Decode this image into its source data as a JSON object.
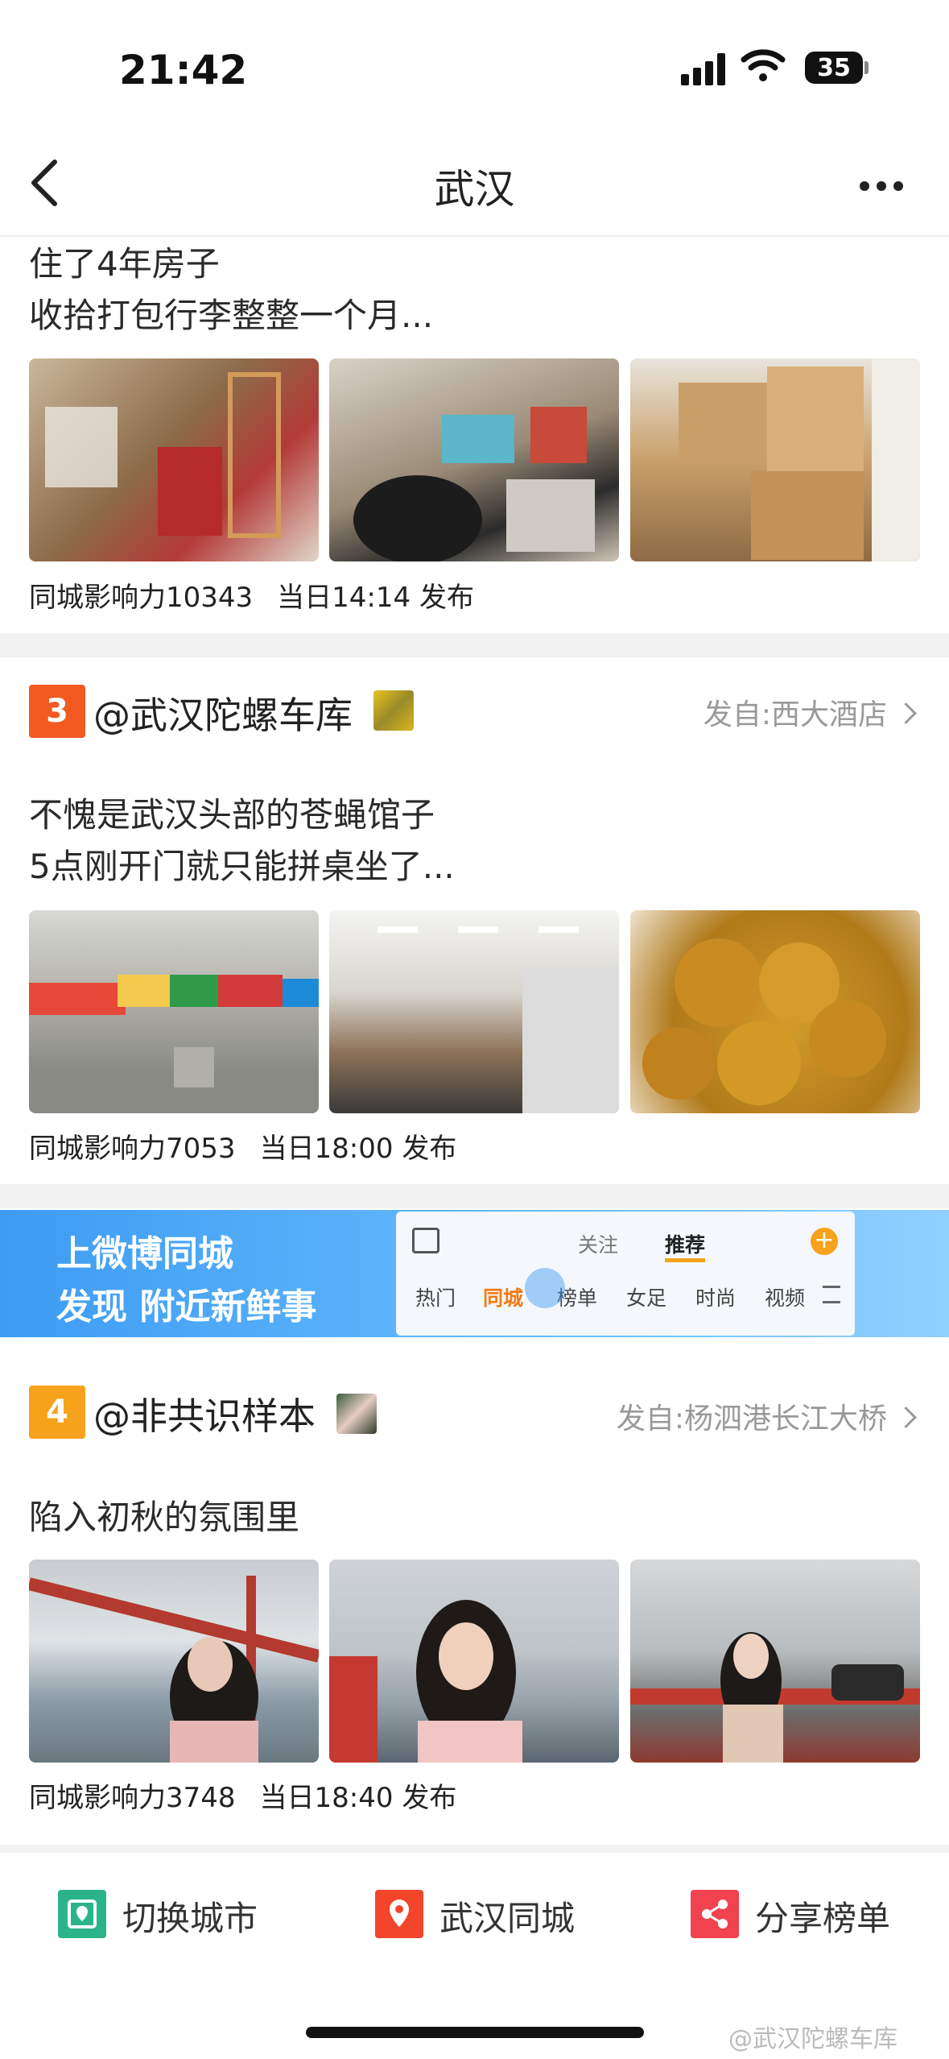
{
  "status": {
    "time": "21:42",
    "battery": "35"
  },
  "nav": {
    "title": "武汉"
  },
  "post1": {
    "text": "住了4年房子\n收拾打包行李整整一个月...",
    "influence_label": "同城影响力",
    "influence_value": "10343",
    "time": "当日14:14 发布"
  },
  "post2": {
    "rank": "3",
    "author": "@武汉陀螺车库",
    "from": "发自:西大酒店",
    "text": "不愧是武汉头部的苍蝇馆子\n5点刚开门就只能拼桌坐了...",
    "influence_label": "同城影响力",
    "influence_value": "7053",
    "time": "当日18:00 发布"
  },
  "banner": {
    "line1": "上微博同城",
    "line2": "发现 附近新鲜事",
    "tab_follow": "关注",
    "tab_recommend": "推荐",
    "cats": [
      "热门",
      "同城",
      "榜单",
      "女足",
      "时尚",
      "视频"
    ]
  },
  "post3": {
    "rank": "4",
    "author": "@非共识样本",
    "from": "发自:杨泗港长江大桥",
    "text": "陷入初秋的氛围里",
    "influence_label": "同城影响力",
    "influence_value": "3748",
    "time": "当日18:40 发布"
  },
  "bottom": {
    "switch_city": "切换城市",
    "city_local": "武汉同城",
    "share_rank": "分享榜单"
  },
  "watermark": "@武汉陀螺车库",
  "colors": {
    "rank3": "#f25a22",
    "rank4": "#f7a21b",
    "switch_icon": "#2bb38a",
    "city_icon": "#f2452c",
    "share_icon": "#f0424f"
  }
}
